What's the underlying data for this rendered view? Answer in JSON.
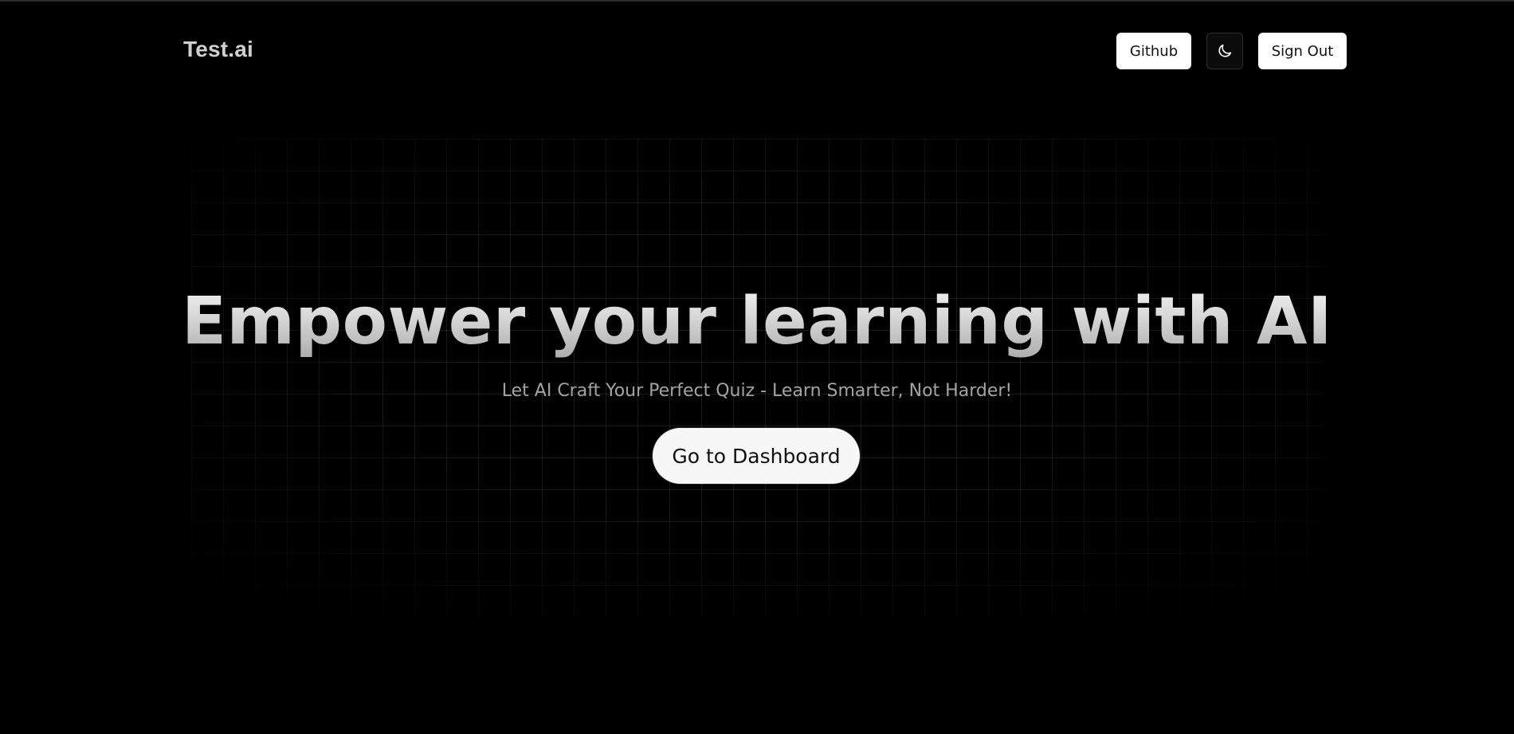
{
  "colors": {
    "background": "#000000",
    "button_bg": "#ffffff",
    "button_text": "#111111",
    "theme_button_bg": "#0b0b0b",
    "subtitle": "#a3a3a3"
  },
  "header": {
    "brand": "Test.ai",
    "github_label": "Github",
    "theme_icon": "moon-icon",
    "signout_label": "Sign Out"
  },
  "hero": {
    "title": "Empower your learning with AI",
    "subtitle": "Let AI Craft Your Perfect Quiz - Learn Smarter, Not Harder!",
    "cta_label": "Go to Dashboard"
  }
}
